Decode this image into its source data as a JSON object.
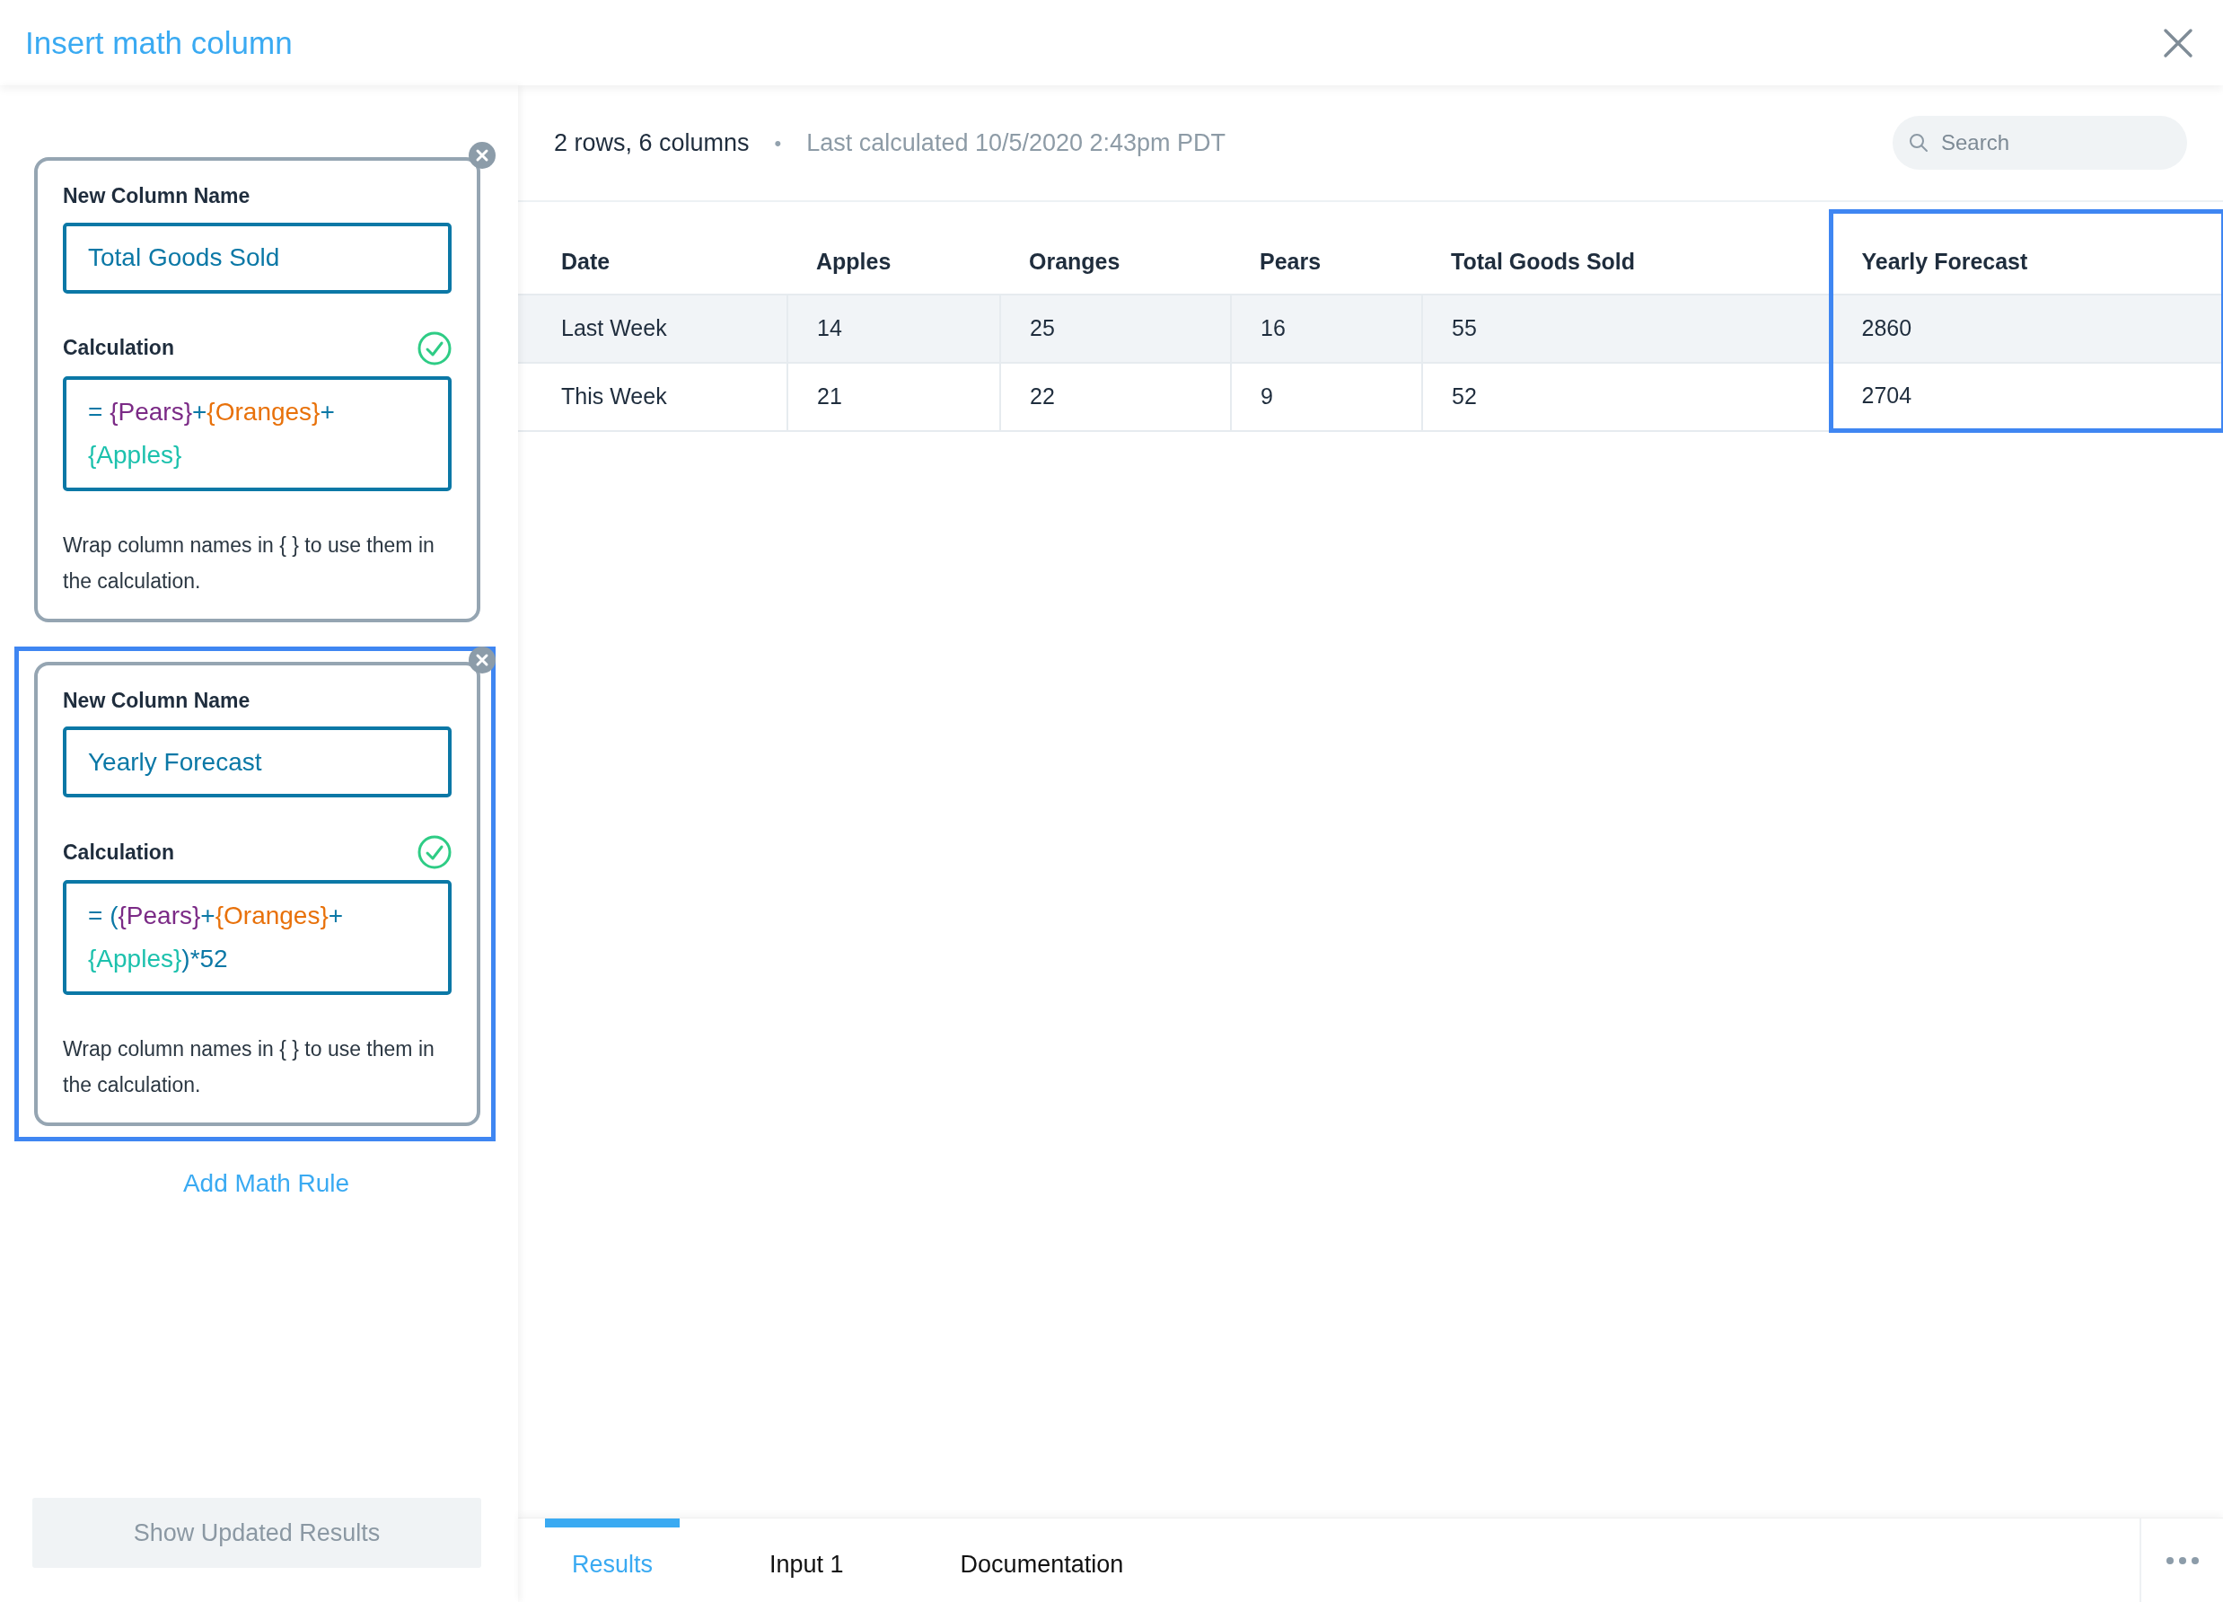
{
  "dialog": {
    "title": "Insert math column"
  },
  "rules": [
    {
      "name_label": "New Column Name",
      "name_value": "Total Goods Sold",
      "calc_label": "Calculation",
      "valid": true,
      "selected": false,
      "tokens": [
        {
          "kind": "text",
          "text": "= "
        },
        {
          "kind": "column",
          "text": "{Pears}",
          "color": "#7b2a86"
        },
        {
          "kind": "text",
          "text": "+"
        },
        {
          "kind": "column",
          "text": "{Oranges}",
          "color": "#e8710a"
        },
        {
          "kind": "text",
          "text": "+ "
        },
        {
          "kind": "column",
          "text": "{Apples}",
          "color": "#1cc1ad"
        }
      ],
      "help": "Wrap column names in { } to use them in the calculation."
    },
    {
      "name_label": "New Column Name",
      "name_value": "Yearly Forecast",
      "calc_label": "Calculation",
      "valid": true,
      "selected": true,
      "tokens": [
        {
          "kind": "text",
          "text": "= ("
        },
        {
          "kind": "column",
          "text": "{Pears}",
          "color": "#7b2a86"
        },
        {
          "kind": "text",
          "text": "+"
        },
        {
          "kind": "column",
          "text": "{Oranges}",
          "color": "#e8710a"
        },
        {
          "kind": "text",
          "text": "+ "
        },
        {
          "kind": "column",
          "text": "{Apples}",
          "color": "#1cc1ad"
        },
        {
          "kind": "text",
          "text": ")*52"
        }
      ],
      "help": "Wrap column names in { } to use them in the calculation."
    }
  ],
  "add_rule": "Add Math Rule",
  "update_button": {
    "label": "Show Updated Results",
    "disabled": true
  },
  "summary": {
    "counts": "2 rows, 6 columns",
    "separator": "•",
    "last_calculated": "Last calculated 10/5/2020 2:43pm PDT"
  },
  "search": {
    "placeholder": "Search"
  },
  "table": {
    "columns": [
      {
        "label": "Date",
        "highlighted": false
      },
      {
        "label": "Apples",
        "highlighted": false
      },
      {
        "label": "Oranges",
        "highlighted": false
      },
      {
        "label": "Pears",
        "highlighted": false
      },
      {
        "label": "Total Goods Sold",
        "highlighted": false
      },
      {
        "label": "Yearly Forecast",
        "highlighted": true
      }
    ],
    "rows": [
      {
        "highlighted": true,
        "cells": [
          "Last Week",
          "14",
          "25",
          "16",
          "55",
          "2860"
        ]
      },
      {
        "highlighted": false,
        "cells": [
          "This Week",
          "21",
          "22",
          "9",
          "52",
          "2704"
        ]
      }
    ]
  },
  "tabs": [
    {
      "label": "Results",
      "selected": true
    },
    {
      "label": "Input 1",
      "selected": false
    },
    {
      "label": "Documentation",
      "selected": false
    }
  ]
}
